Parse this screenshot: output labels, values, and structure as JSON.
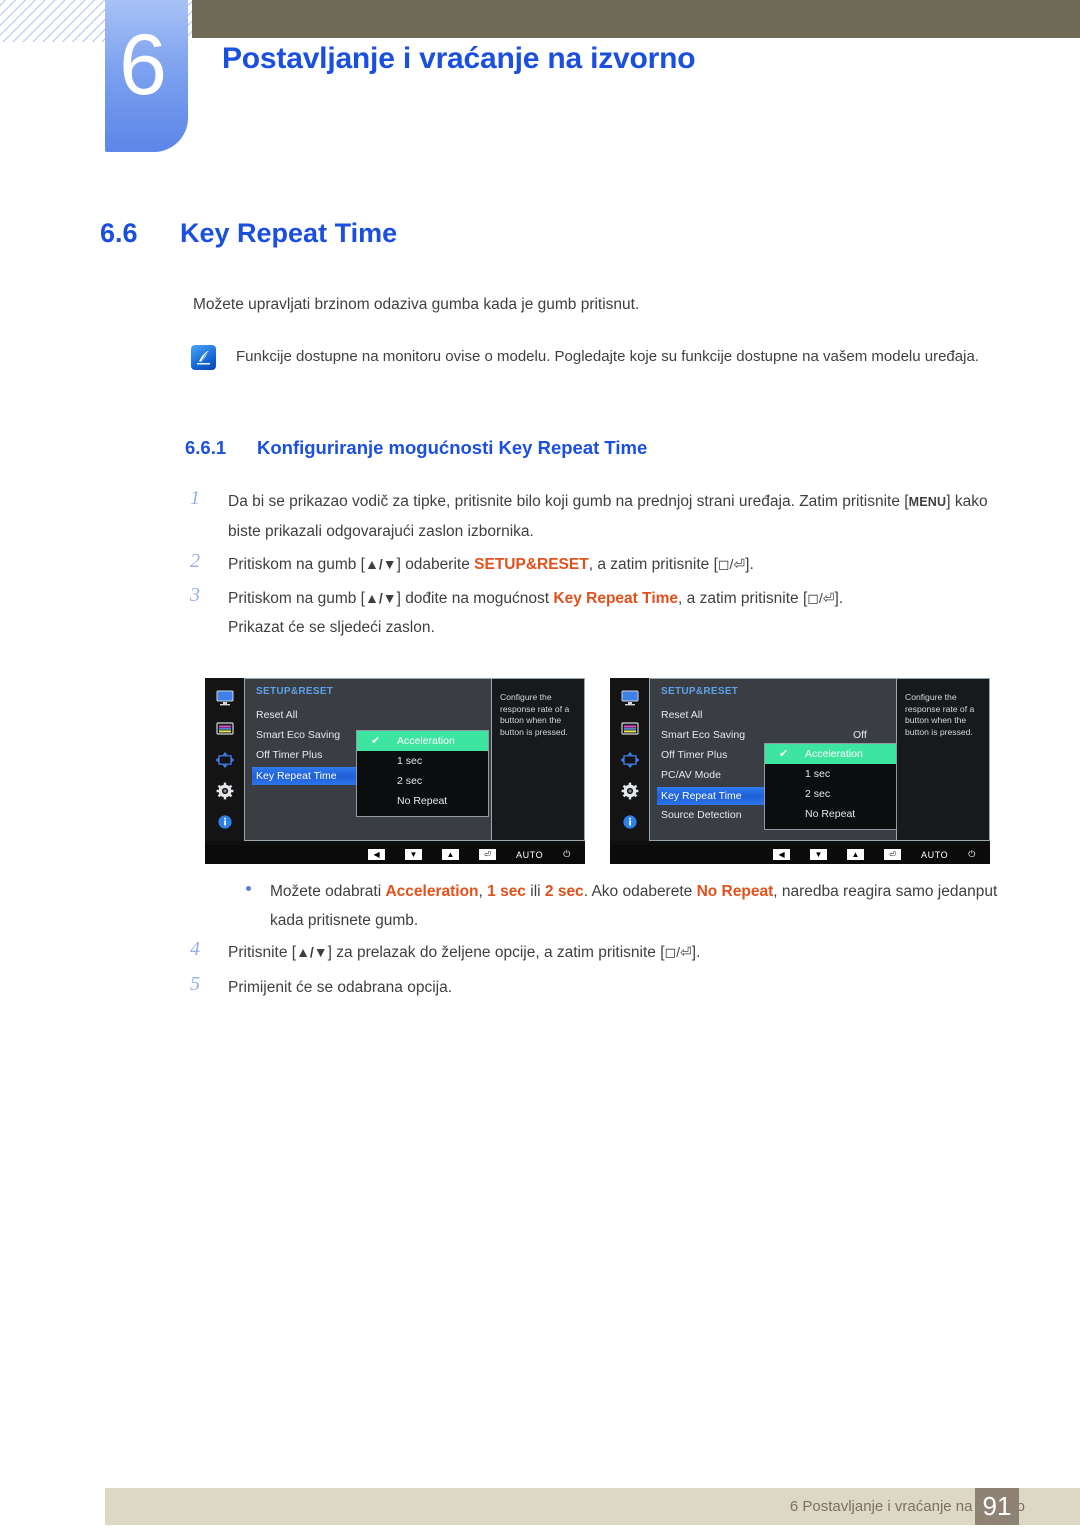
{
  "header": {
    "chapter_number": "6",
    "chapter_title": "Postavljanje i vraćanje na izvorno"
  },
  "section": {
    "number": "6.6",
    "title": "Key Repeat Time",
    "intro": "Možete upravljati brzinom odaziva gumba kada je gumb pritisnut.",
    "note_icon": "note-pen-icon",
    "note": "Funkcije dostupne na monitoru ovise o modelu. Pogledajte koje su funkcije dostupne na vašem modelu uređaja."
  },
  "subsection": {
    "number": "6.6.1",
    "title": "Konfiguriranje mogućnosti Key Repeat Time"
  },
  "steps": {
    "s1_num": "1",
    "s1_a": "Da bi se prikazao vodič za tipke, pritisnite bilo koji gumb na prednjoj strani uređaja. Zatim pritisnite [",
    "s1_key": "MENU",
    "s1_b": "] kako biste prikazali odgovarajući zaslon izbornika.",
    "s2_num": "2",
    "s2_a": "Pritiskom na gumb [",
    "s2_updown": "▲/▼",
    "s2_b": "] odaberite ",
    "s2_kw": "SETUP&RESET",
    "s2_c": ", a zatim pritisnite [",
    "s2_enter": "◻/⏎",
    "s2_d": "].",
    "s3_num": "3",
    "s3_a": "Pritiskom na gumb [",
    "s3_updown": "▲/▼",
    "s3_b": "] dođite na mogućnost ",
    "s3_kw": "Key Repeat Time",
    "s3_c": ", a zatim pritisnite [",
    "s3_enter": "◻/⏎",
    "s3_d": "].",
    "s3_e": "Prikazat će se sljedeći zaslon.",
    "s4_num": "4",
    "s4_a": "Pritisnite [",
    "s4_updown": "▲/▼",
    "s4_b": "] za prelazak do željene opcije, a zatim pritisnite [",
    "s4_enter": "◻/⏎",
    "s4_c": "].",
    "s5_num": "5",
    "s5_a": "Primijenit će se odabrana opcija."
  },
  "bullet": {
    "a": "Možete odabrati ",
    "kw1": "Acceleration",
    "b": ", ",
    "kw2": "1 sec",
    "c": " ili ",
    "kw3": "2 sec",
    "d": ". Ako odaberete ",
    "kw4": "No Repeat",
    "e": ", naredba reagira samo jedanput kada pritisnete gumb."
  },
  "osd": {
    "icons": [
      "monitor-icon",
      "picture-icon",
      "position-arrows-icon",
      "gear-icon",
      "info-icon"
    ],
    "title": "SETUP&RESET",
    "description": "Configure the response rate of a button when the button is pressed.",
    "popup_options": [
      "Acceleration",
      "1 sec",
      "2 sec",
      "No Repeat"
    ],
    "popup_selected": "Acceleration",
    "check_glyph": "✔",
    "keybar": {
      "left": "◀",
      "down": "▼",
      "up": "▲",
      "enter": "⏎",
      "auto": "AUTO",
      "power": "⏻"
    },
    "left_screen": {
      "items": [
        "Reset All",
        "Smart Eco Saving",
        "Off Timer Plus",
        "Key Repeat Time"
      ],
      "highlighted": "Key Repeat Time",
      "values": []
    },
    "right_screen": {
      "items": [
        "Reset All",
        "Smart Eco Saving",
        "Off Timer Plus",
        "PC/AV Mode",
        "Key Repeat Time",
        "Source Detection"
      ],
      "highlighted": "Key Repeat Time",
      "smart_eco_value": "Off"
    }
  },
  "footer": {
    "text": "6 Postavljanje i vraćanje na izvorno",
    "page": "91"
  },
  "colors": {
    "heading_blue": "#1a4fe0",
    "keyword_orange": "#e2501b",
    "olive": "#6e6a55",
    "footer_bar": "#ddd8c4",
    "footer_page_box": "#8d8273",
    "osd_green": "#3ee5a0",
    "osd_blue": "#2f7bf0"
  }
}
